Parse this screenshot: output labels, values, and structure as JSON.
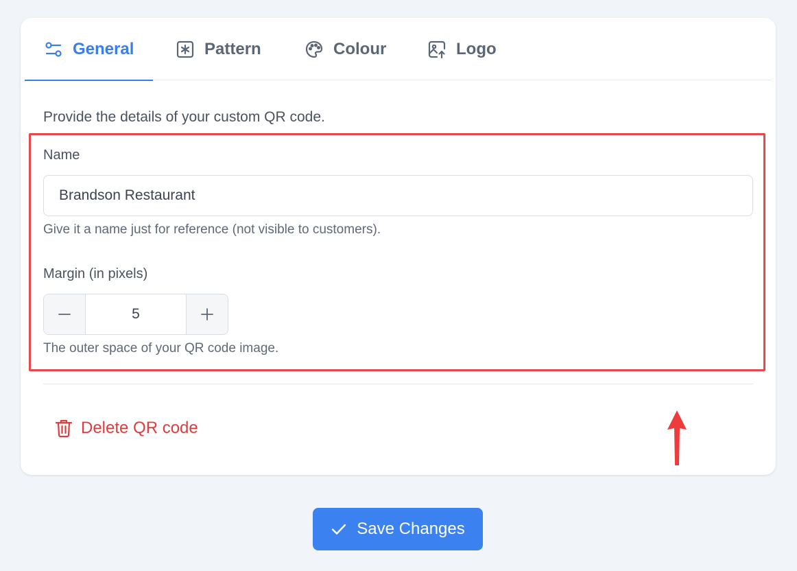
{
  "tabs": [
    {
      "label": "General",
      "icon": "sliders-icon",
      "active": true
    },
    {
      "label": "Pattern",
      "icon": "asterisk-square-icon",
      "active": false
    },
    {
      "label": "Colour",
      "icon": "palette-icon",
      "active": false
    },
    {
      "label": "Logo",
      "icon": "image-upload-icon",
      "active": false
    }
  ],
  "form": {
    "intro": "Provide the details of your custom QR code.",
    "name_label": "Name",
    "name_value": "Brandson Restaurant",
    "name_help": "Give it a name just for reference (not visible to customers).",
    "margin_label": "Margin (in pixels)",
    "margin_value": "5",
    "margin_help": "The outer space of your QR code image."
  },
  "actions": {
    "delete_label": "Delete QR code",
    "save_label": "Save Changes"
  },
  "colors": {
    "accent": "#3b7ee8",
    "danger": "#e23b3b",
    "highlight": "#e8474c"
  }
}
